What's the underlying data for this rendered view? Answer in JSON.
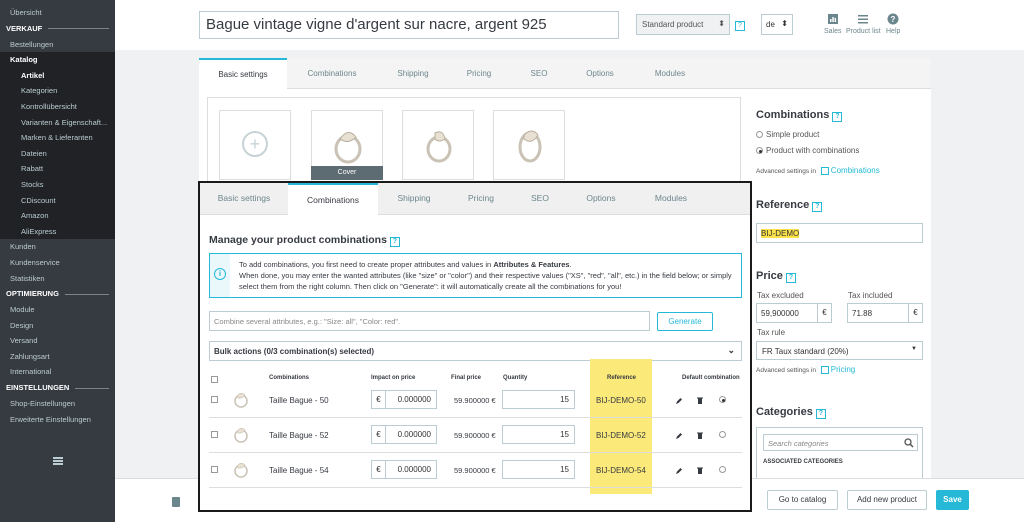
{
  "sidebar": {
    "items": [
      {
        "label": "Übersicht",
        "type": "item"
      },
      {
        "label": "VERKAUF",
        "type": "section"
      },
      {
        "label": "Bestellungen",
        "type": "item"
      },
      {
        "label": "Katalog",
        "type": "active-parent"
      },
      {
        "label": "Artikel",
        "type": "sub-active"
      },
      {
        "label": "Kategorien",
        "type": "sub"
      },
      {
        "label": "Kontrollübersicht",
        "type": "sub"
      },
      {
        "label": "Varianten & Eigenschaft...",
        "type": "sub"
      },
      {
        "label": "Marken & Lieferanten",
        "type": "sub"
      },
      {
        "label": "Dateien",
        "type": "sub"
      },
      {
        "label": "Rabatt",
        "type": "sub"
      },
      {
        "label": "Stocks",
        "type": "sub"
      },
      {
        "label": "CDiscount",
        "type": "sub"
      },
      {
        "label": "Amazon",
        "type": "sub"
      },
      {
        "label": "AliExpress",
        "type": "sub"
      },
      {
        "label": "Kunden",
        "type": "item"
      },
      {
        "label": "Kundenservice",
        "type": "item"
      },
      {
        "label": "Statistiken",
        "type": "item"
      },
      {
        "label": "OPTIMIERUNG",
        "type": "section"
      },
      {
        "label": "Module",
        "type": "item"
      },
      {
        "label": "Design",
        "type": "item"
      },
      {
        "label": "Versand",
        "type": "item"
      },
      {
        "label": "Zahlungsart",
        "type": "item"
      },
      {
        "label": "International",
        "type": "item"
      },
      {
        "label": "EINSTELLUNGEN",
        "type": "section"
      },
      {
        "label": "Shop-Einstellungen",
        "type": "item"
      },
      {
        "label": "Erweiterte Einstellungen",
        "type": "item"
      }
    ]
  },
  "header": {
    "product_name": "Bague vintage vigne d'argent sur nacre, argent 925",
    "product_type": "Standard product",
    "help_mark": "?",
    "language": "de",
    "sales_label": "Sales",
    "product_list_label": "Product list",
    "help_label": "Help"
  },
  "tabs": [
    "Basic settings",
    "Combinations",
    "Shipping",
    "Pricing",
    "SEO",
    "Options",
    "Modules"
  ],
  "images": {
    "add_glyph": "+",
    "cover_label": "Cover"
  },
  "right": {
    "combinations_title": "Combinations",
    "simple_product": "Simple product",
    "product_with_combinations": "Product with combinations",
    "advanced_settings_in": "Advanced settings in",
    "combinations_link": "Combinations",
    "reference_title": "Reference",
    "reference_value": "BIJ-DEMO",
    "price_title": "Price",
    "tax_excluded_label": "Tax excluded",
    "tax_included_label": "Tax included",
    "tax_excluded_value": "59,900000",
    "tax_included_value": "71.88",
    "currency": "€",
    "tax_rule_label": "Tax rule",
    "tax_rule_value": "FR Taux standard (20%)",
    "pricing_link": "Pricing",
    "categories_title": "Categories",
    "search_categories_placeholder": "Search categories",
    "associated_categories": "ASSOCIATED CATEGORIES"
  },
  "footer": {
    "go_to_catalog": "Go to catalog",
    "add_new_product": "Add new product",
    "save": "Save"
  },
  "overlay": {
    "title": "Manage your product combinations",
    "info_line1_pre": "To add combinations, you first need to create proper attributes and values in ",
    "info_line1_bold": "Attributes & Features",
    "info_line1_post": ".",
    "info_line2": "When done, you may enter the wanted attributes (like \"size\" or \"color\") and their respective values (\"XS\", \"red\", \"all\", etc.) in the field below; or simply select them from the right column. Then click on \"Generate\": it will automatically create all the combinations for you!",
    "combine_placeholder": "Combine several attributes, e.g.: \"Size: all\", \"Color: red\".",
    "generate": "Generate",
    "bulk_actions": "Bulk actions (0/3 combination(s) selected)",
    "columns": {
      "combinations": "Combinations",
      "impact": "Impact on price",
      "final": "Final price",
      "quantity": "Quantity",
      "reference": "Reference",
      "default": "Default combination"
    },
    "rows": [
      {
        "name": "Taille Bague - 50",
        "impact": "0.000000",
        "final": "59.900000 €",
        "qty": "15",
        "ref": "BIJ-DEMO-50",
        "default": true
      },
      {
        "name": "Taille Bague - 52",
        "impact": "0.000000",
        "final": "59.900000 €",
        "qty": "15",
        "ref": "BIJ-DEMO-52",
        "default": false
      },
      {
        "name": "Taille Bague - 54",
        "impact": "0.000000",
        "final": "59.900000 €",
        "qty": "15",
        "ref": "BIJ-DEMO-54",
        "default": false
      }
    ]
  }
}
